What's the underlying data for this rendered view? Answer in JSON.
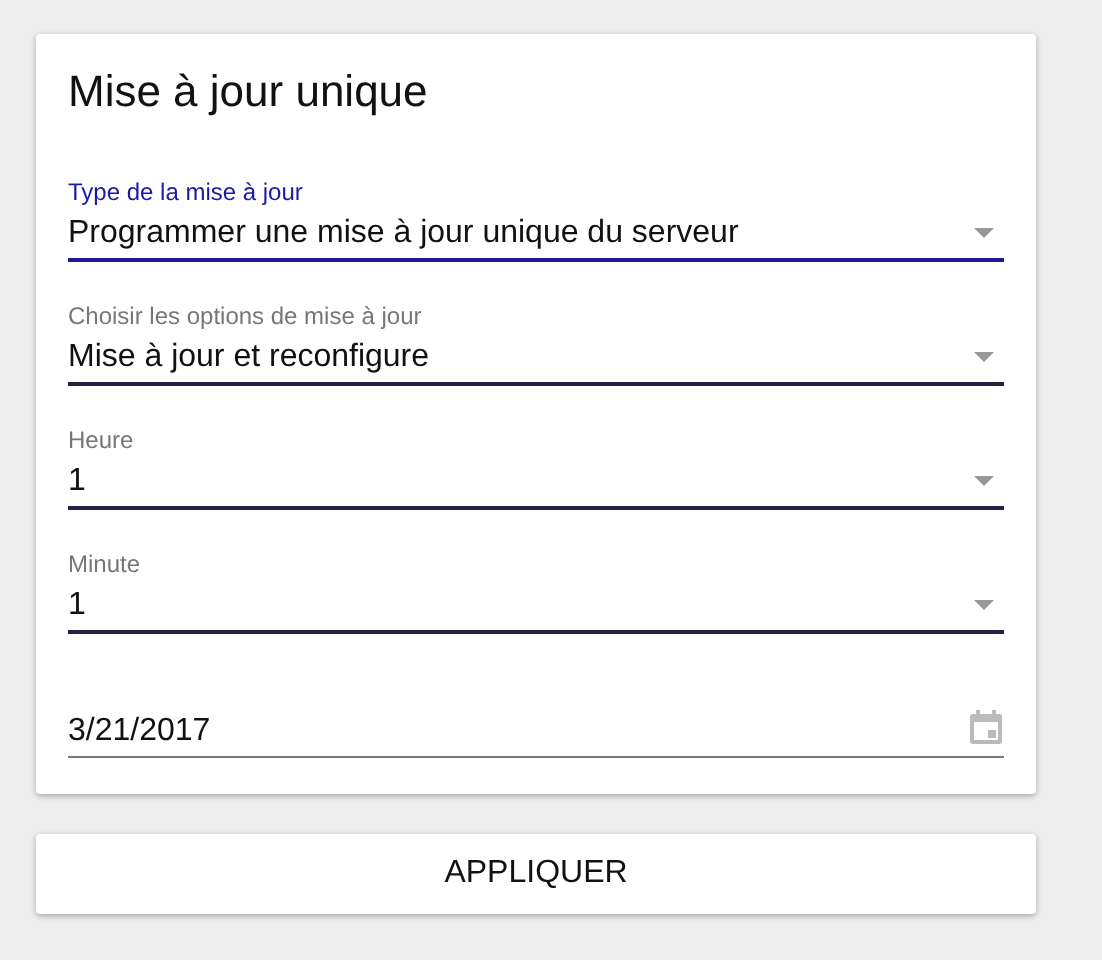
{
  "card": {
    "title": "Mise à jour unique",
    "fields": [
      {
        "kind": "select",
        "label": "Type de la mise à jour",
        "value": "Programmer une mise à jour unique du serveur",
        "focused": true
      },
      {
        "kind": "select",
        "label": "Choisir les options de mise à jour",
        "value": "Mise à jour et reconfigure",
        "focused": false
      },
      {
        "kind": "select",
        "label": "Heure",
        "value": "1",
        "focused": false
      },
      {
        "kind": "select",
        "label": "Minute",
        "value": "1",
        "focused": false
      },
      {
        "kind": "date",
        "value": "3/21/2017"
      }
    ]
  },
  "buttons": [
    "APPLIQUER"
  ]
}
